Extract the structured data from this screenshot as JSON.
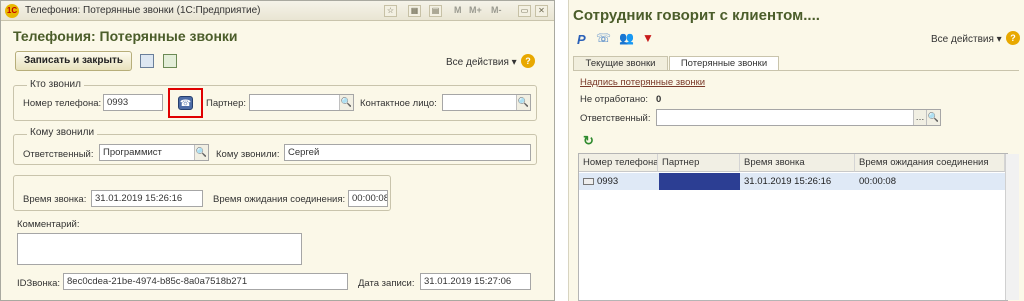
{
  "left": {
    "window_title": "Телефония: Потерянные звонки  (1С:Предприятие)",
    "titlebar_buttons": [
      "M",
      "M+",
      "M-"
    ],
    "form_title": "Телефония: Потерянные звонки",
    "save_close_label": "Записать и закрыть",
    "all_actions": "Все действия ▾",
    "help": "?",
    "who_called": {
      "group_title": "Кто звонил",
      "phone_label": "Номер телефона:",
      "phone_value": "0993",
      "partner_label": "Партнер:",
      "partner_value": "",
      "contact_label": "Контактное лицо:",
      "contact_value": ""
    },
    "whom_called": {
      "group_title": "Кому звонили",
      "responsible_label": "Ответственный:",
      "responsible_value": "Программист",
      "to_whom_label": "Кому звонили:",
      "to_whom_value": "Сергей"
    },
    "call_time_label": "Время звонка:",
    "call_time_value": "31.01.2019 15:26:16",
    "wait_label": "Время ожидания соединения:",
    "wait_value": "00:00:08",
    "comment_label": "Комментарий:",
    "comment_value": "",
    "id_label": "IDЗвонка:",
    "id_value": "8ec0cdea-21be-4974-b85c-8a0a7518b271",
    "record_date_label": "Дата записи:",
    "record_date_value": "31.01.2019 15:27:06"
  },
  "right": {
    "title": "Сотрудник говорит с клиентом....",
    "all_actions": "Все действия ▾",
    "help": "?",
    "tabs": [
      {
        "label": "Текущие звонки"
      },
      {
        "label": "Потерянные звонки"
      }
    ],
    "lost_calls_link": "Надпись потерянные звонки",
    "not_processed_label": "Не отработано:",
    "not_processed_value": "0",
    "responsible_label": "Ответственный:",
    "responsible_value": "",
    "grid": {
      "columns": [
        "Номер телефона",
        "Партнер",
        "Время звонка",
        "Время ожидания соединения"
      ],
      "rows": [
        {
          "phone": "0993",
          "partner": "",
          "time": "31.01.2019 15:26:16",
          "wait": "00:00:08"
        }
      ]
    }
  },
  "colors": {
    "title_green": "#4b5d2a",
    "highlight_red": "#e00000",
    "selected_row": "#dfe9f6",
    "partner_cell": "#2c3e93"
  }
}
